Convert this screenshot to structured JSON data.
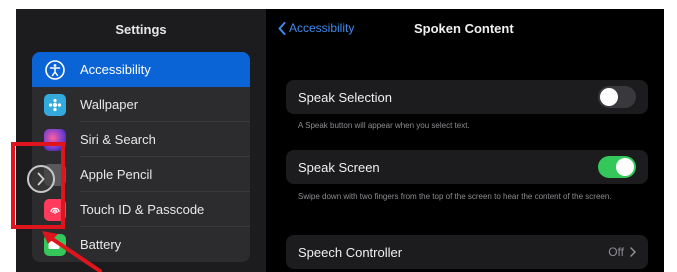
{
  "sidebar": {
    "title": "Settings",
    "items": [
      {
        "label": "Accessibility",
        "icon": "accessibility-icon",
        "color": "#0a64d6",
        "active": true
      },
      {
        "label": "Wallpaper",
        "icon": "wallpaper-icon",
        "color": "#34aadc",
        "active": false
      },
      {
        "label": "Siri & Search",
        "icon": "siri-icon",
        "color": "#6e3bd0",
        "active": false
      },
      {
        "label": "Apple Pencil",
        "icon": "pencil-icon",
        "color": "#5a5a5e",
        "active": false
      },
      {
        "label": "Touch ID & Passcode",
        "icon": "fingerprint-icon",
        "color": "#ff3b5c",
        "active": false
      },
      {
        "label": "Battery",
        "icon": "battery-icon",
        "color": "#34c759",
        "active": false
      }
    ]
  },
  "nav": {
    "back_label": "Accessibility",
    "title": "Spoken Content"
  },
  "settings": {
    "speak_selection": {
      "label": "Speak Selection",
      "enabled": false,
      "footnote": "A Speak button will appear when you select text."
    },
    "speak_screen": {
      "label": "Speak Screen",
      "enabled": true,
      "footnote": "Swipe down with two fingers from the top of the screen to hear the content of the screen."
    },
    "speech_controller": {
      "label": "Speech Controller",
      "value": "Off"
    }
  },
  "colors": {
    "accent": "#0a64d6",
    "toggle_on": "#34c759",
    "annotation": "#e0141d"
  }
}
